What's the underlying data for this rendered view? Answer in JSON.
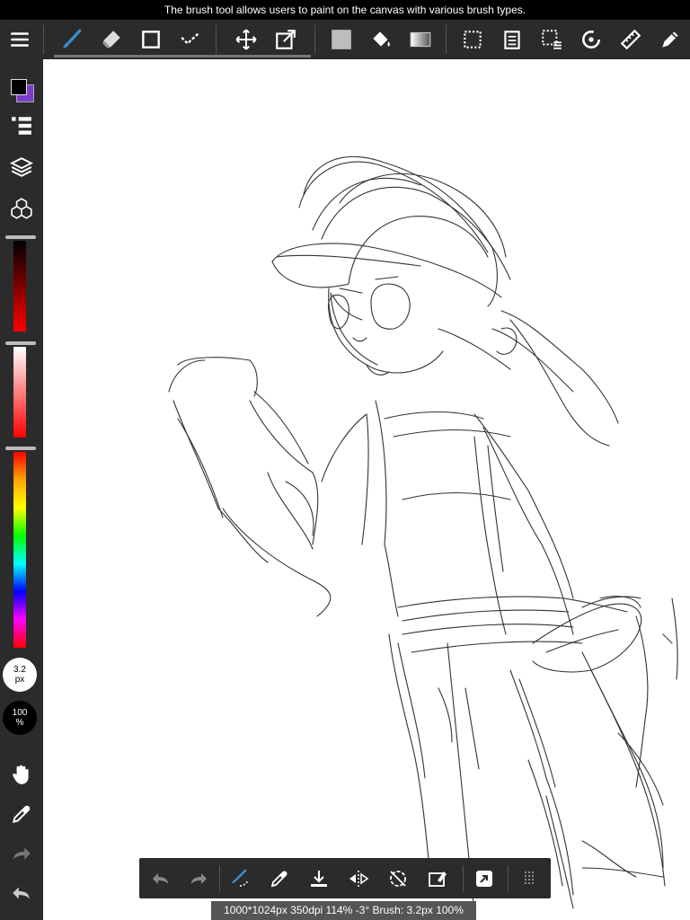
{
  "tooltip": "The brush tool allows users to paint on the canvas with various brush types.",
  "toolbar": {
    "tools": [
      {
        "name": "menu-icon"
      },
      {
        "name": "brush-icon",
        "selected": true
      },
      {
        "name": "eraser-icon"
      },
      {
        "name": "shape-icon"
      },
      {
        "name": "select-check-icon"
      },
      {
        "name": "move-icon"
      },
      {
        "name": "transform-icon"
      },
      {
        "name": "fill-color-icon"
      },
      {
        "name": "bucket-icon"
      },
      {
        "name": "gradient-icon"
      },
      {
        "name": "marquee-icon"
      },
      {
        "name": "page-icon"
      },
      {
        "name": "selection-menu-icon"
      },
      {
        "name": "rotate-icon"
      },
      {
        "name": "ruler-icon"
      },
      {
        "name": "pen-icon"
      }
    ],
    "accent_color": "#3a8fd0"
  },
  "sidebar": {
    "primary_color": "#000000",
    "secondary_color": "#7d3cc8",
    "brush_size": {
      "value": "3.2",
      "unit": "px"
    },
    "opacity": {
      "value": "100",
      "unit": "%"
    }
  },
  "bottom_toolbar": {
    "items": [
      "undo-icon",
      "redo-icon",
      "brush-stabilizer-icon",
      "eyedropper-icon",
      "save-icon",
      "flip-icon",
      "rotate-reset-icon",
      "clear-icon",
      "share-icon",
      "grid-menu-icon"
    ]
  },
  "status": "1000*1024px 350dpi 114% -3° Brush: 3.2px 100%"
}
